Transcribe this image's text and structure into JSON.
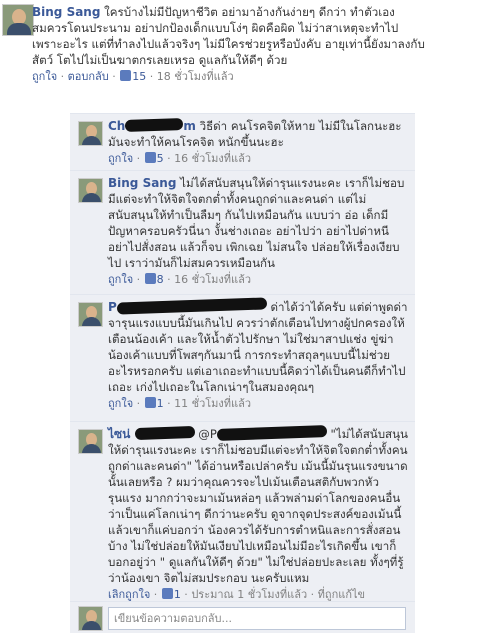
{
  "post": {
    "author": "Bing Sang",
    "text": "ใครบ้างไม่มีปัญหาชีวิต อย่ามาอ้างกันง่ายๆ ดีกว่า ทำตัวเอง สมควรโดนประนาม อย่าปกป้องเด็กแบบโง่ๆ ผิดคือผิด ไม่ว่าสาเหตุจะทำไปเพราะอะไร แต่ที่ทำลงไปแล้วจริงๆ ไม่มีใครช่วยรูหรือบังคับ อายุเท่านี้ยังมาลงกับสัตว์ โตไปไม่เป็นฆาตกรเลยเหรอ ดูแลกันให้ดีๆ ด้วย",
    "meta": {
      "like": "ถูกใจ",
      "sep1": " · ",
      "reply": "ตอบกลับ",
      "sep2": " · ",
      "likes": "15",
      "sep3": " · ",
      "time": "18 ชั่วโมงที่แล้ว"
    }
  },
  "comments": [
    {
      "author": "Ch",
      "author_tail": "m",
      "text": "วิธีด่า คนโรคจิตให้หาย ไม่มีในโลกนะฮะ มันจะทำให้คนโรคจิต หนักขึ้นนะฮะ",
      "meta": {
        "like": "ถูกใจ",
        "sep1": " · ",
        "likes": "5",
        "sep2": " · ",
        "time": "16 ชั่วโมงที่แล้ว"
      }
    },
    {
      "author": "Bing Sang",
      "author_tail": "",
      "text": "ไม่ได้สนับสนุนให้ด่ารุนแรงนะคะ เราก็ไม่ชอบมีแต่จะทำให้จิตใจตกต่ำทั้งคนถูกด่าและคนด่า แต่ไม่สนับสนุนให้ทำเป็นลืมๆ กันไปเหมือนกัน แบบว่า อ่อ เด็กมีปัญหาครอบครัวนี่นา งั้นช่างเถอะ อย่าไปว่า อย่าไปด่าหนี อย่าไปสั่งสอน แล้วก็จบ เพิกเฉย ไม่สนใจ ปล่อยให้เรื่องเงียบไป เราว่ามันก็ไม่สมควรเหมือนกัน",
      "meta": {
        "like": "ถูกใจ",
        "sep1": " · ",
        "likes": "8",
        "sep2": " · ",
        "time": "16 ชั่วโมงที่แล้ว"
      }
    },
    {
      "author": "P",
      "author_tail": "",
      "text": "ด่าได้ว่าได้ครับ แต่ด่าพูดด่าจารุนแรงแบบนี้มันเกินไป ควรว่าตักเตือนไปทางผู้ปกครองให้เตือนน้องเค้า และให้น้ำตัวไปรักษา ไม่ใช่มาสาปแช่ง ขู่ฆ่า น้องเค้าแบบที่โพสๆกันมานี่ การกระทำสถุลๆแบบนี้ไม่ช่วยอะไรหรอกครับ แต่เอาเถอะทำแบบนี้คิดว่าได้เป็นคนดีก็ทำไปเถอะ เก่งไปเถอะในโลกเน่าๆในสมองคุณๆ",
      "meta": {
        "like": "ถูกใจ",
        "sep1": " · ",
        "likes": "1",
        "sep2": " · ",
        "time": "11 ชั่วโมงที่แล้ว"
      }
    },
    {
      "author": "ไซน่ ",
      "author_tail": "@P",
      "text": "\"ไม่ได้สนับสนุนให้ด่ารุนแรงนะคะ เราก็ไม่ชอบมีแต่จะทำให้จิตใจตกต่ำทั้งคนถูกด่าและคนด่า\" ได้อ่านหรือเปล่าครับ เม้นนี้มันรุนแรงขนาดนั้นเลยหรือ ? ผมว่าคุณควรจะไปเม้นเตือนสติกับพวกหัวรุนแรง มากกว่าจะมาเม้นหล่อๆ แล้วพล่ามด่าโลกของคนอื่นว่าเป็นแค่โลกเน่าๆ ดีกว่านะครับ ดูจากจุดประสงค์ของเม้นนี้แล้วเขาก็แค่บอกว่า น้องควรได้รับการตำหนิและการสั่งสอนบ้าง ไม่ใช่ปล่อยให้มันเงียบไปเหมือนไม่มีอะไรเกิดขึ้น เขาก็บอกอยู่ว่า \" ดูแลกันให้ดีๆ ด้วย\" ไม่ใช่ปล่อยปะละเลย ทั้งๆที่รู้ว่าน้องเขา จิตไม่สมประกอบ นะครับแหม",
      "meta": {
        "like": "เลิกถูกใจ",
        "sep1": " · ",
        "likes": "1",
        "sep2": " · ",
        "time": "ประมาณ 1 ชั่วโมงที่แล้ว",
        "sep3": " · ",
        "extra": "ที่ถูกแก้ไข"
      }
    }
  ],
  "reply": {
    "placeholder": "เขียนข้อความตอบกลับ..."
  },
  "colors": {
    "link": "#3b5998",
    "comment_bg": "#edeff4",
    "meta_gray": "#808080"
  },
  "icons": {
    "like": "thumbs-up-icon"
  }
}
